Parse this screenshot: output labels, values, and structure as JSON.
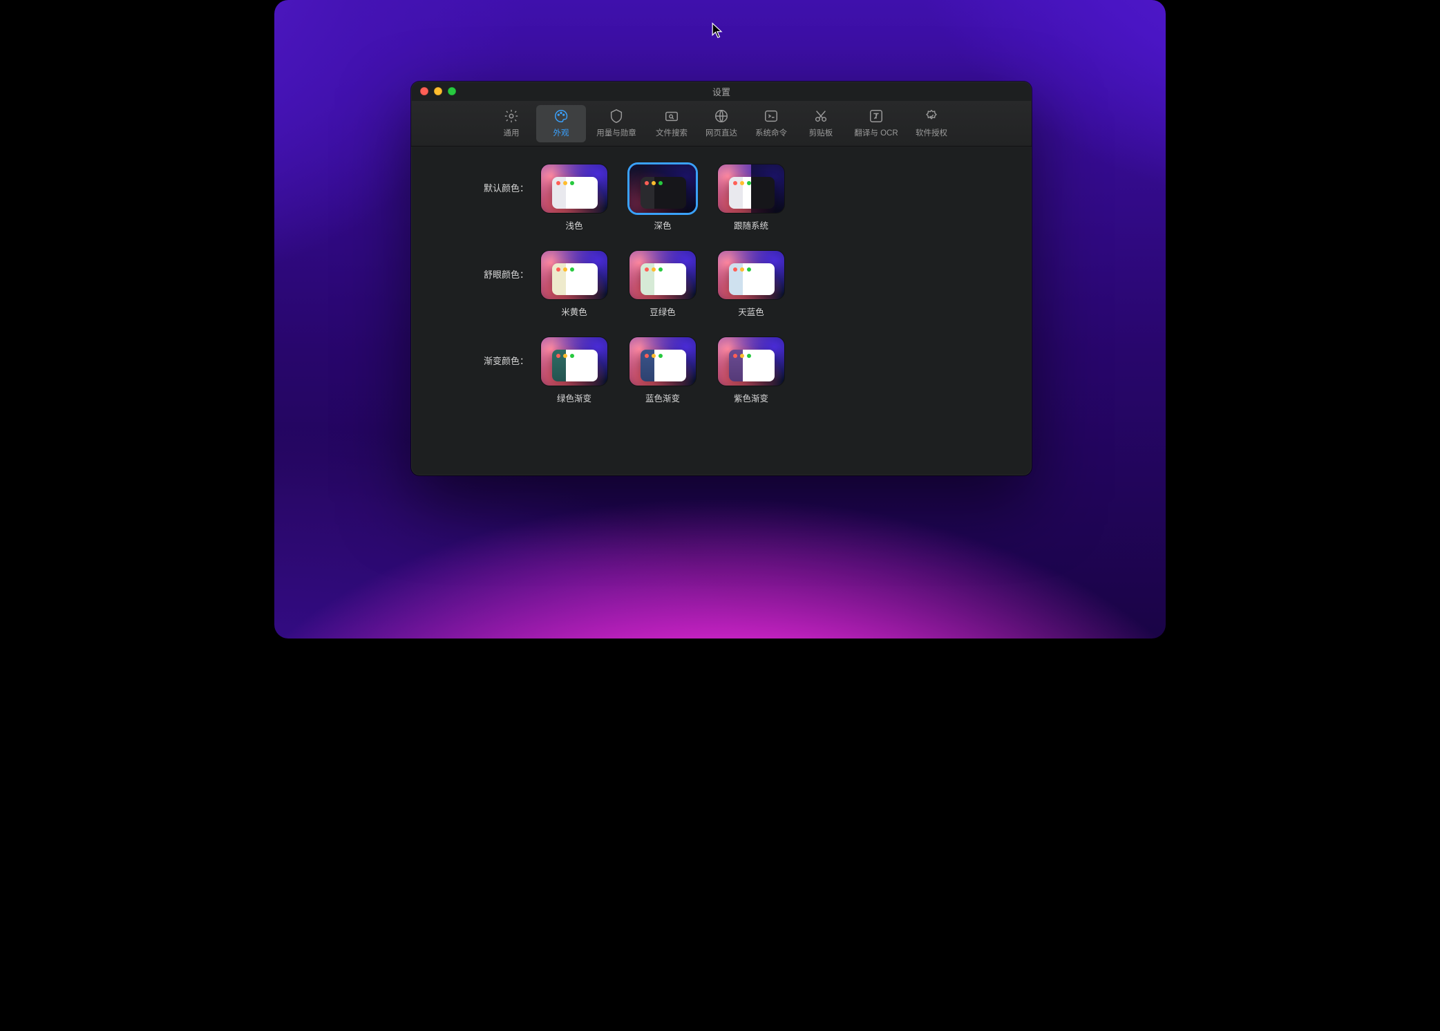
{
  "window": {
    "title": "设置"
  },
  "tabs": [
    {
      "id": "general",
      "label": "通用"
    },
    {
      "id": "appearance",
      "label": "外观"
    },
    {
      "id": "usage",
      "label": "用量与勋章"
    },
    {
      "id": "filesearch",
      "label": "文件搜索"
    },
    {
      "id": "webopen",
      "label": "网页直达"
    },
    {
      "id": "shell",
      "label": "系统命令"
    },
    {
      "id": "clipboard",
      "label": "剪贴板"
    },
    {
      "id": "ocr",
      "label": "翻译与 OCR"
    },
    {
      "id": "license",
      "label": "软件授权"
    }
  ],
  "sections": {
    "default": {
      "label": "默认颜色：",
      "options": [
        "浅色",
        "深色",
        "跟随系统"
      ]
    },
    "comfort": {
      "label": "舒眼颜色：",
      "options": [
        "米黄色",
        "豆绿色",
        "天蓝色"
      ]
    },
    "gradient": {
      "label": "渐变颜色：",
      "options": [
        "绿色渐变",
        "蓝色渐变",
        "紫色渐变"
      ]
    }
  },
  "selected_theme": "深色",
  "selected_tab": "appearance"
}
